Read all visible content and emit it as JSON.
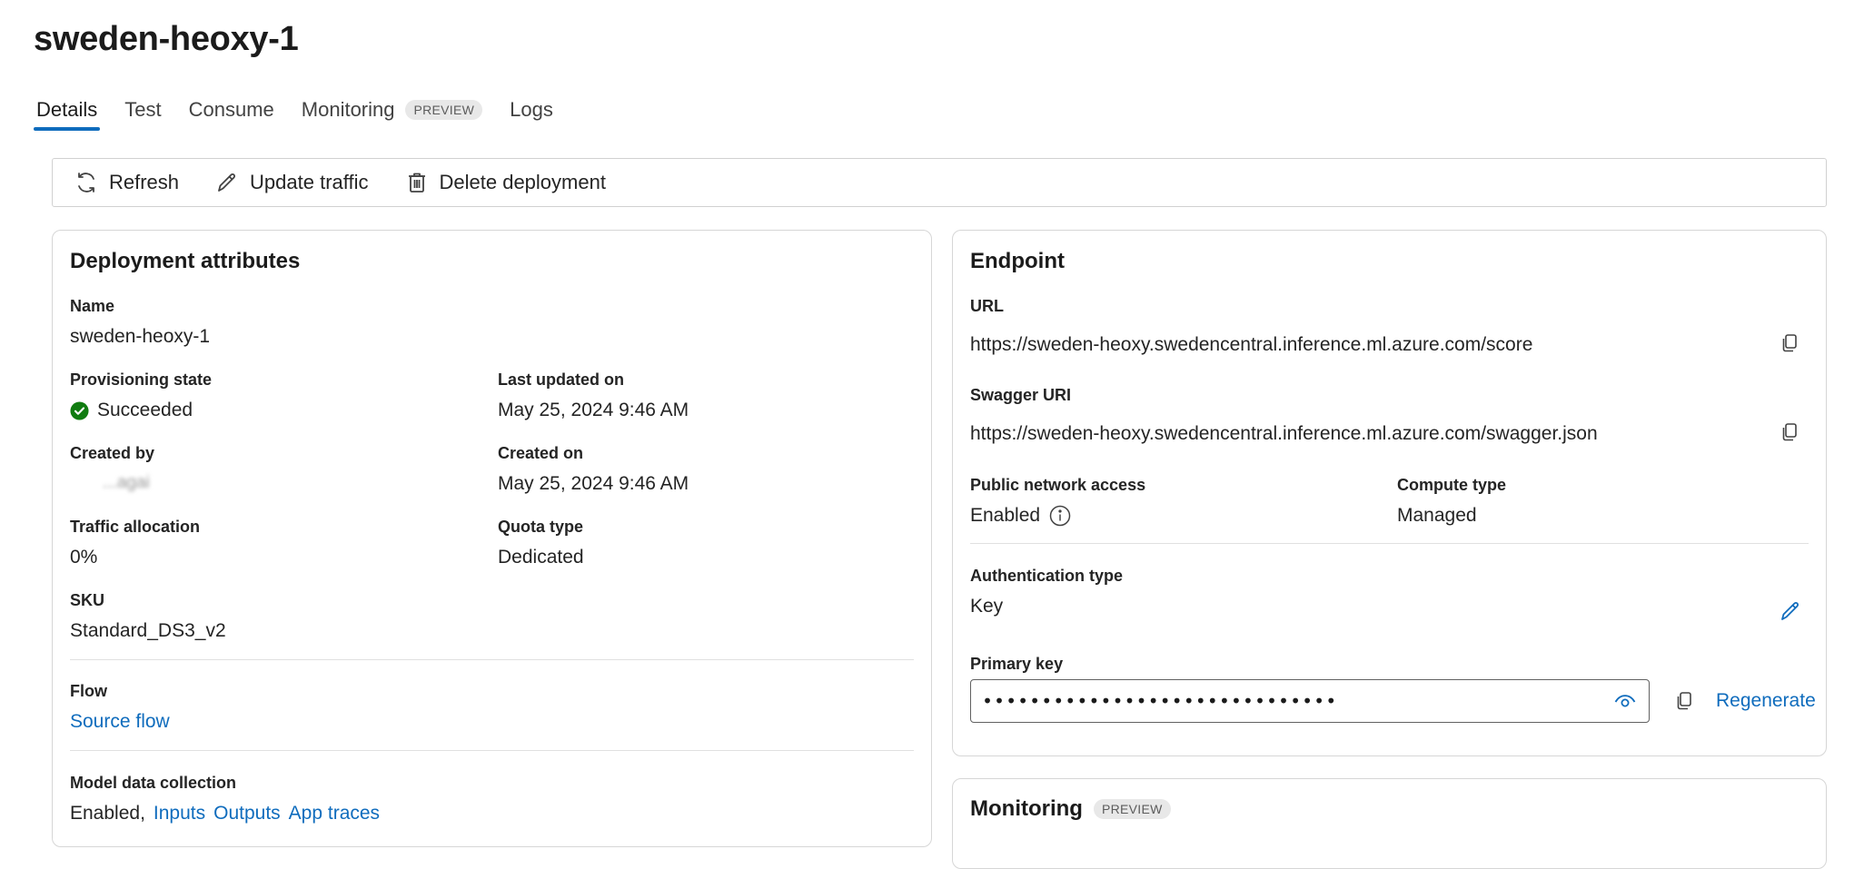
{
  "page": {
    "title": "sweden-heoxy-1"
  },
  "tabs": [
    {
      "label": "Details",
      "active": true
    },
    {
      "label": "Test"
    },
    {
      "label": "Consume"
    },
    {
      "label": "Monitoring",
      "badge": "PREVIEW"
    },
    {
      "label": "Logs"
    }
  ],
  "toolbar": {
    "refresh": "Refresh",
    "update_traffic": "Update traffic",
    "delete_deployment": "Delete deployment"
  },
  "deployment": {
    "title": "Deployment attributes",
    "name_label": "Name",
    "name_value": "sweden-heoxy-1",
    "provisioning_label": "Provisioning state",
    "provisioning_value": "Succeeded",
    "last_updated_label": "Last updated on",
    "last_updated_value": "May 25, 2024 9:46 AM",
    "created_by_label": "Created by",
    "created_by_value": "...agai",
    "created_on_label": "Created on",
    "created_on_value": "May 25, 2024 9:46 AM",
    "traffic_label": "Traffic allocation",
    "traffic_value": "0%",
    "quota_label": "Quota type",
    "quota_value": "Dedicated",
    "sku_label": "SKU",
    "sku_value": "Standard_DS3_v2",
    "flow_label": "Flow",
    "flow_link": "Source flow",
    "mdc_label": "Model data collection",
    "mdc_value": "Enabled,",
    "mdc_links": [
      "Inputs",
      "Outputs",
      "App traces"
    ]
  },
  "endpoint": {
    "title": "Endpoint",
    "url_label": "URL",
    "url_value": "https://sweden-heoxy.swedencentral.inference.ml.azure.com/score",
    "swagger_label": "Swagger URI",
    "swagger_value": "https://sweden-heoxy.swedencentral.inference.ml.azure.com/swagger.json",
    "pna_label": "Public network access",
    "pna_value": "Enabled",
    "compute_label": "Compute type",
    "compute_value": "Managed",
    "auth_label": "Authentication type",
    "auth_value": "Key",
    "primary_key_label": "Primary key",
    "primary_key_value": "••••••••••••••••••••••••••••••",
    "regenerate": "Regenerate"
  },
  "monitoring": {
    "title": "Monitoring",
    "badge": "PREVIEW"
  },
  "colors": {
    "accent": "#0f6cbd",
    "success": "#107c10"
  },
  "icons": [
    "refresh-icon",
    "pencil-icon",
    "trash-icon",
    "check-circle-icon",
    "copy-icon",
    "info-icon",
    "eye-icon"
  ]
}
